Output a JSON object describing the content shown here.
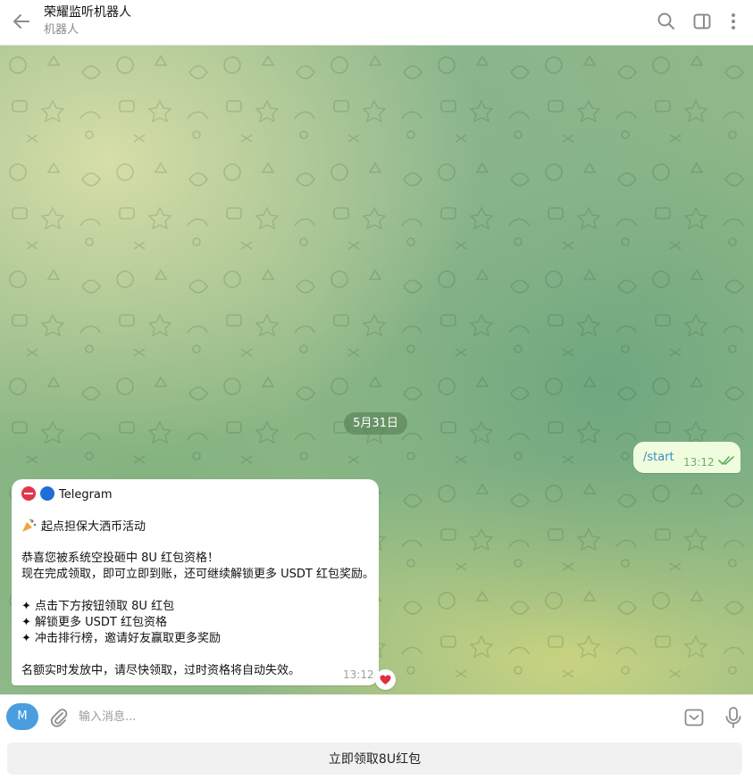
{
  "header": {
    "title": "荣耀监听机器人",
    "subtitle": "机器人",
    "icons": [
      "back-arrow-icon",
      "search-icon",
      "sidebar-panel-icon",
      "more-vertical-icon"
    ]
  },
  "chat": {
    "date_label": "5月31日",
    "outgoing": {
      "text": "/start",
      "time": "13:12",
      "status_icon": "double-check-icon"
    },
    "incoming": {
      "line1": "Telegram",
      "line2": "起点担保大洒币活动",
      "line3": "恭喜您被系统空投砸中 8U 红包资格！",
      "line4": "现在完成领取，即可立即到账，还可继续解锁更多 USDT 红包奖励。",
      "line5": "✦ 点击下方按钮领取 8U 红包",
      "line6": "✦ 解锁更多 USDT 红包资格",
      "line7": "✦ 冲击排行榜，邀请好友赢取更多奖励",
      "line8": "名额实时发放中，请尽快领取，过时资格将自动失效。",
      "time": "13:12",
      "reaction": "heart-icon"
    }
  },
  "composer": {
    "avatar_letter": "M",
    "placeholder": "输入消息...",
    "icons": [
      "paperclip-icon",
      "keyboard-icon",
      "microphone-icon"
    ]
  },
  "bottom_button": {
    "label": "立即领取8U红包"
  },
  "colors": {
    "outgoing_bubble": "#effdde",
    "link_blue": "#3a8bc4",
    "avatar_blue": "#4a9ee0",
    "heart_red": "#e0303e"
  }
}
